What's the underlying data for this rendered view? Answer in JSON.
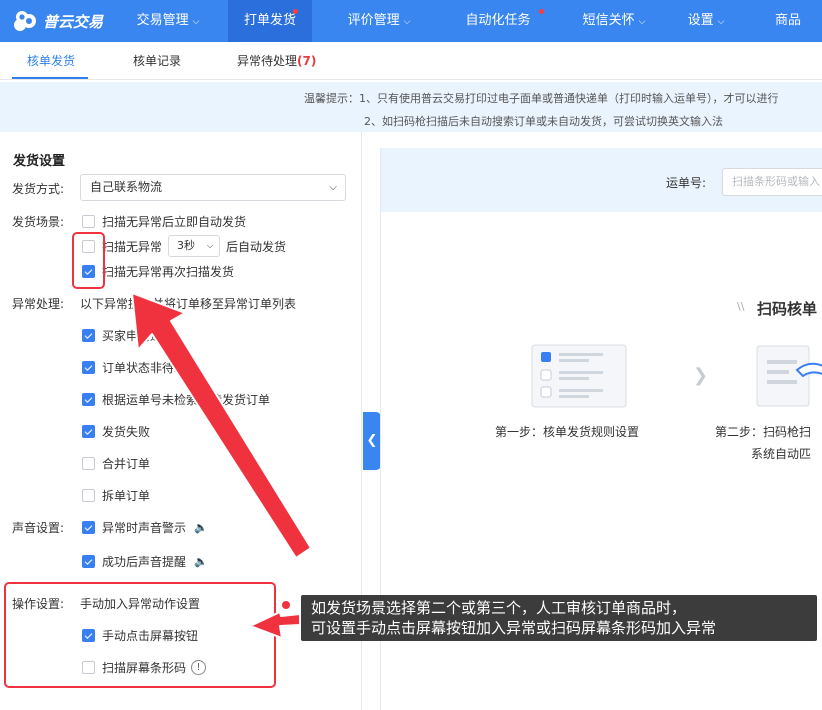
{
  "brand": {
    "name": "普云交易"
  },
  "nav": {
    "items": [
      {
        "label": "交易管理",
        "chevron": true,
        "dot": false
      },
      {
        "label": "打单发货",
        "chevron": false,
        "dot": true
      },
      {
        "label": "评价管理",
        "chevron": true,
        "dot": false
      },
      {
        "label": "自动化任务",
        "chevron": false,
        "dot": true
      },
      {
        "label": "短信关怀",
        "chevron": true,
        "dot": false
      },
      {
        "label": "设置",
        "chevron": true,
        "dot": false
      },
      {
        "label": "商品",
        "chevron": false,
        "dot": false
      }
    ],
    "active_index": 1
  },
  "subtabs": {
    "verify": "核单发货",
    "records": "核单记录",
    "pending": "异常待处理",
    "pending_count": "(7)"
  },
  "notice": {
    "line1": "温馨提示：1、只有使用普云交易打印过电子面单或普通快递单（打印时输入运单号），才可以进行",
    "line2": "2、如扫码枪扫描后未自动搜索订单或未自动发货，可尝试切换英文输入法"
  },
  "settings": {
    "title": "发货设置",
    "ship_method_label": "发货方式:",
    "ship_method_value": "自己联系物流",
    "scene_label": "发货场景:",
    "scene_options": [
      {
        "label": "扫描无异常后立即自动发货",
        "checked": false
      },
      {
        "label_before": "扫描无异常",
        "delay_value": "3秒",
        "label_after": "后自动发货",
        "checked": false
      },
      {
        "label": "扫描无异常再次扫描发货",
        "checked": true
      }
    ],
    "exception_label": "异常处理:",
    "exception_desc": "以下异常提示并将订单移至异常订单列表",
    "exception_options": [
      {
        "label": "买家申请退款",
        "checked": true
      },
      {
        "label": "订单状态非待发货",
        "checked": true
      },
      {
        "label": "根据运单号未检索到待发货订单",
        "checked": true
      },
      {
        "label": "发货失败",
        "checked": true
      },
      {
        "label": "合并订单",
        "checked": false
      },
      {
        "label": "拆单订单",
        "checked": false
      }
    ],
    "sound_label": "声音设置:",
    "sound_options": [
      {
        "label": "异常时声音警示",
        "checked": true
      },
      {
        "label": "成功后声音提醒",
        "checked": true
      }
    ],
    "operation_label": "操作设置:",
    "operation_desc": "手动加入异常动作设置",
    "operation_options": [
      {
        "label": "手动点击屏幕按钮",
        "checked": true
      },
      {
        "label": "扫描屏幕条形码",
        "checked": false
      }
    ]
  },
  "right": {
    "waybill_label": "运单号:",
    "waybill_placeholder": "扫描条形码或输入",
    "scan_title": "扫码核单",
    "step1": "第一步：核单发货规则设置",
    "step2_line1": "第二步：扫码枪扫",
    "step2_line2": "系统自动匹"
  },
  "callout": {
    "line1": "如发货场景选择第二个或第三个，人工审核订单商品时，",
    "line2": "可设置手动点击屏幕按钮加入异常或扫码屏幕条形码加入异常"
  },
  "colors": {
    "primary": "#3a86f0",
    "annotation_red": "#f0323f",
    "tab_active": "#2f80ed",
    "notice_bg": "#eaf4fe"
  }
}
